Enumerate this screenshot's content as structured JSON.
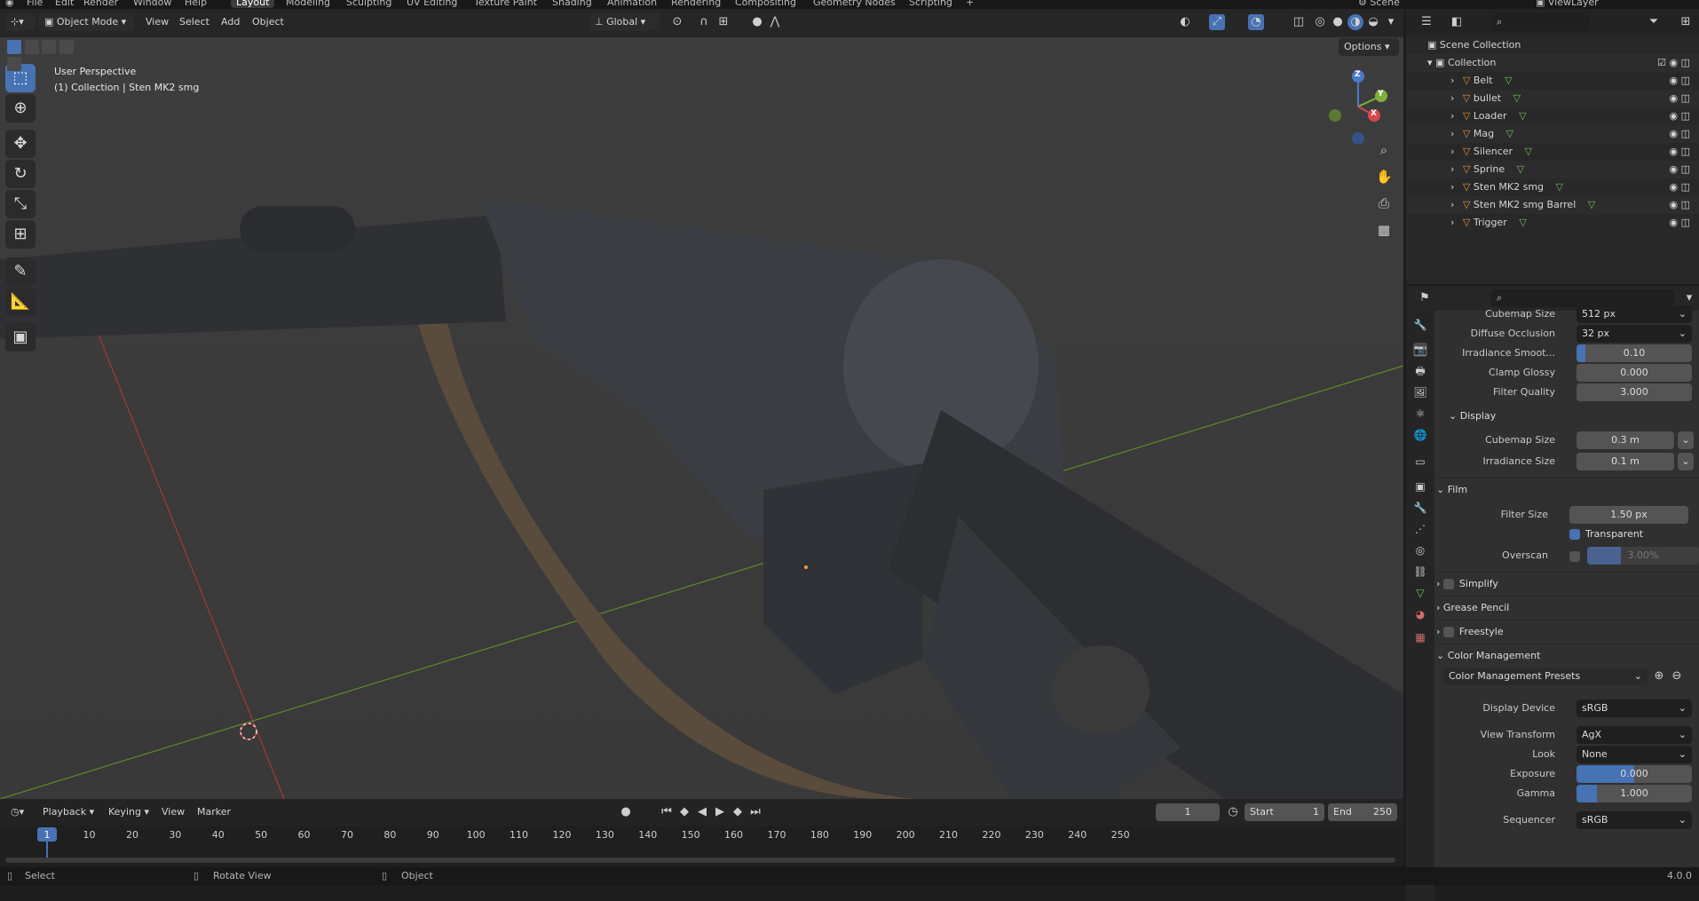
{
  "menus": [
    "File",
    "Edit",
    "Render",
    "Window",
    "Help"
  ],
  "workspaces": [
    "Layout",
    "Modeling",
    "Sculpting",
    "UV Editing",
    "Texture Paint",
    "Shading",
    "Animation",
    "Rendering",
    "Compositing",
    "Geometry Nodes",
    "Scripting"
  ],
  "workspace_add": "+",
  "scene_name": "Scene",
  "view_layer": "ViewLayer",
  "viewport": {
    "mode": "Object Mode",
    "menus": [
      "View",
      "Select",
      "Add",
      "Object"
    ],
    "orientation": "Global",
    "options_label": "Options",
    "info_line1": "User Perspective",
    "info_line2": "(1) Collection | Sten MK2 smg",
    "gizmo": {
      "z": "Z",
      "y": "Y",
      "x": "X"
    }
  },
  "tools": [
    "select-box-icon",
    "cursor-icon",
    "move-icon",
    "rotate-icon",
    "scale-icon",
    "transform-icon",
    "annotate-icon",
    "measure-icon",
    "add-cube-icon"
  ],
  "outliner": {
    "scene_collection": "Scene Collection",
    "collection": "Collection",
    "items": [
      "Belt",
      "bullet",
      "Loader",
      "Mag",
      "Silencer",
      "Sprine",
      "Sten MK2 smg",
      "Sten MK2 smg Barrel",
      "Trigger"
    ]
  },
  "properties": {
    "cubemap_size_label": "Cubemap Size",
    "cubemap_size_value": "512 px",
    "diffuse_occlusion_label": "Diffuse Occlusion",
    "diffuse_occlusion_value": "32 px",
    "irradiance_smooth_label": "Irradiance Smoot...",
    "irradiance_smooth_value": "0.10",
    "irradiance_smooth_fill": 0.08,
    "clamp_glossy_label": "Clamp Glossy",
    "clamp_glossy_value": "0.000",
    "filter_quality_label": "Filter Quality",
    "filter_quality_value": "3.000",
    "display_section": "Display",
    "display_cubemap_label": "Cubemap Size",
    "display_cubemap_value": "0.3 m",
    "display_irradiance_label": "Irradiance Size",
    "display_irradiance_value": "0.1 m",
    "film_section": "Film",
    "filter_size_label": "Filter Size",
    "filter_size_value": "1.50 px",
    "transparent_label": "Transparent",
    "overscan_label": "Overscan",
    "overscan_value": "3.00%",
    "overscan_fill": 0.3,
    "simplify_section": "Simplify",
    "grease_pencil_section": "Grease Pencil",
    "freestyle_section": "Freestyle",
    "color_mgmt_section": "Color Management",
    "color_mgmt_presets": "Color Management Presets",
    "display_device_label": "Display Device",
    "display_device_value": "sRGB",
    "view_transform_label": "View Transform",
    "view_transform_value": "AgX",
    "look_label": "Look",
    "look_value": "None",
    "exposure_label": "Exposure",
    "exposure_value": "0.000",
    "exposure_fill": 0.5,
    "gamma_label": "Gamma",
    "gamma_value": "1.000",
    "gamma_fill": 0.18,
    "sequencer_label": "Sequencer",
    "sequencer_value": "sRGB"
  },
  "timeline": {
    "menus": [
      "Playback",
      "Keying",
      "View",
      "Marker"
    ],
    "current_frame": "1",
    "start_label": "Start",
    "start_value": "1",
    "end_label": "End",
    "end_value": "250",
    "ticks": [
      "1",
      "10",
      "20",
      "30",
      "40",
      "50",
      "60",
      "70",
      "80",
      "90",
      "100",
      "110",
      "120",
      "130",
      "140",
      "150",
      "160",
      "170",
      "180",
      "190",
      "200",
      "210",
      "220",
      "230",
      "240",
      "250"
    ]
  },
  "status": {
    "select": "Select",
    "rotate_view": "Rotate View",
    "object": "Object",
    "version": "4.0.0"
  }
}
